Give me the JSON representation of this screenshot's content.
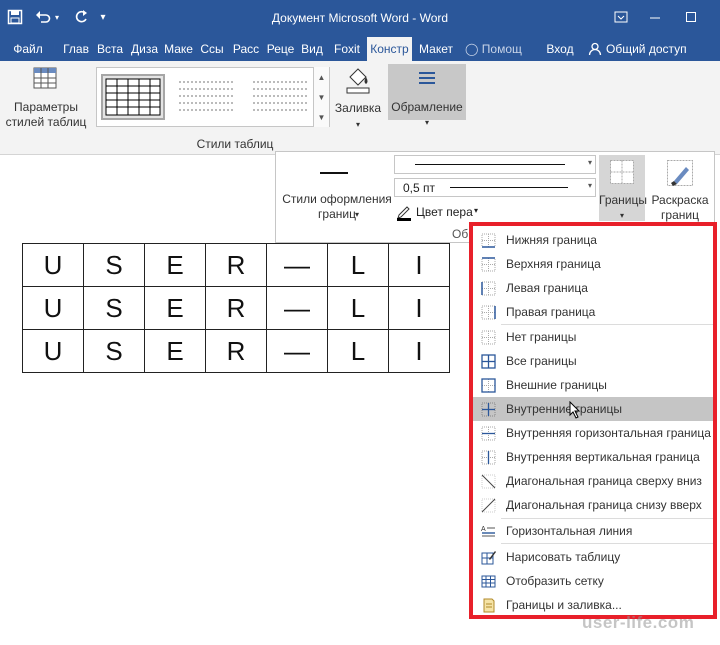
{
  "window": {
    "title": "Документ Microsoft Word - Word"
  },
  "tabs": [
    "Файл",
    "Глав",
    "Вста",
    "Диза",
    "Маке",
    "Ссы",
    "Расс",
    "Реце",
    "Вид",
    "Foxit",
    "Констр",
    "Макет"
  ],
  "active_tab": "Констр",
  "tell_me": "Помощ",
  "signin": "Вход",
  "share": "Общий доступ",
  "ribbon": {
    "table_style_params": "Параметры стилей таблиц",
    "table_styles_group": "Стили таблиц",
    "shading": "Заливка",
    "borders_group": "Обрамление",
    "border_styles": "Стили оформления границ",
    "line_weight": "0,5 пт",
    "pen_color": "Цвет пера",
    "borders_btn": "Границы",
    "border_painter": "Раскраска границ",
    "panel_group_partial": "Об"
  },
  "document": {
    "rows": [
      [
        "U",
        "S",
        "E",
        "R",
        "—",
        "L",
        "I"
      ],
      [
        "U",
        "S",
        "E",
        "R",
        "—",
        "L",
        "I"
      ],
      [
        "U",
        "S",
        "E",
        "R",
        "—",
        "L",
        "I"
      ]
    ]
  },
  "menu": {
    "items": [
      {
        "label": "Нижняя граница",
        "icon": "border-bottom-icon"
      },
      {
        "label": "Верхняя граница",
        "icon": "border-top-icon"
      },
      {
        "label": "Левая граница",
        "icon": "border-left-icon"
      },
      {
        "label": "Правая граница",
        "icon": "border-right-icon"
      },
      {
        "label": "Нет границы",
        "icon": "border-none-icon"
      },
      {
        "label": "Все границы",
        "icon": "border-all-icon"
      },
      {
        "label": "Внешние границы",
        "icon": "border-outside-icon"
      },
      {
        "label": "Внутренние границы",
        "icon": "border-inside-icon"
      },
      {
        "label": "Внутренняя горизонтальная граница",
        "icon": "border-inside-horizontal-icon"
      },
      {
        "label": "Внутренняя вертикальная граница",
        "icon": "border-inside-vertical-icon"
      },
      {
        "label": "Диагональная граница сверху вниз",
        "icon": "diagonal-down-icon"
      },
      {
        "label": "Диагональная граница снизу вверх",
        "icon": "diagonal-up-icon"
      },
      {
        "label": "Горизонтальная линия",
        "icon": "horizontal-line-icon"
      },
      {
        "label": "Нарисовать таблицу",
        "icon": "draw-table-icon"
      },
      {
        "label": "Отобразить сетку",
        "icon": "view-gridlines-icon"
      },
      {
        "label": "Границы и заливка...",
        "icon": "borders-shading-icon"
      }
    ],
    "hovered": "Внутренние границы"
  },
  "watermark": "user-life.com",
  "colors": {
    "word_blue": "#2b579a",
    "highlight_red": "#e8202a",
    "hover_gray": "#c5c5c5"
  }
}
